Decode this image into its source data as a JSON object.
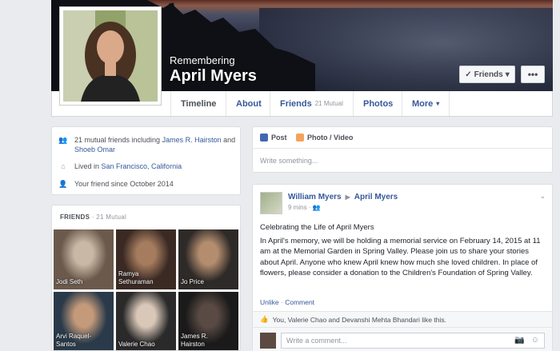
{
  "header": {
    "remembering": "Remembering",
    "name": "April Myers",
    "friends_button": "Friends",
    "more_button": "•••"
  },
  "tabs": [
    {
      "label": "Timeline",
      "extra": ""
    },
    {
      "label": "About",
      "extra": ""
    },
    {
      "label": "Friends",
      "extra": "21 Mutual"
    },
    {
      "label": "Photos",
      "extra": ""
    },
    {
      "label": "More",
      "extra": ""
    }
  ],
  "intro": {
    "mutual_prefix": "21 mutual friends including ",
    "mutual_link1": "James R. Hairston",
    "mutual_and": " and ",
    "mutual_link2": "Shoeb Omar",
    "lived_prefix": "Lived in ",
    "lived_link": "San Francisco, California",
    "friend_since": "Your friend since October 2014"
  },
  "friends": {
    "title": "FRIENDS",
    "count": " · 21 Mutual",
    "tiles": [
      {
        "name": "Jodi Seth",
        "color1": "#6b5a4c",
        "color2": "#c9b8a5"
      },
      {
        "name": "Ramya\nSethuraman",
        "color1": "#3b2a24",
        "color2": "#a57c5e"
      },
      {
        "name": "Jo Price",
        "color1": "#2e2a28",
        "color2": "#b38d6e"
      },
      {
        "name": "Arvi Raquel-\nSantos",
        "color1": "#2a3a4a",
        "color2": "#c49a7a"
      },
      {
        "name": "Valerie Chao",
        "color1": "#2a2a2a",
        "color2": "#d9c7b8"
      },
      {
        "name": "James R.\nHairston",
        "color1": "#1a1a1a",
        "color2": "#5a4a44"
      }
    ]
  },
  "composer": {
    "post_tab": "Post",
    "photo_tab": "Photo / Video",
    "placeholder": "Write something..."
  },
  "post": {
    "author": "William Myers",
    "target": "April Myers",
    "time": "9 mins",
    "line1": "Celebrating the Life of April Myers",
    "body": "In April's memory, we will be holding a memorial service on February 14, 2015 at 11 am at the Memorial Garden in Spring Valley. Please join us to share your stories about April. Anyone who knew April knew how much she loved children. In place of flowers, please consider a donation to the Children's Foundation of Spring Valley.",
    "unlike": "Unlike",
    "comment": "Comment",
    "likes": "You, Valerie Chao and Devanshi Mehta Bhandari like this.",
    "comment_placeholder": "Write a comment..."
  },
  "colors": {
    "link": "#365899",
    "background": "#e9ebee"
  }
}
